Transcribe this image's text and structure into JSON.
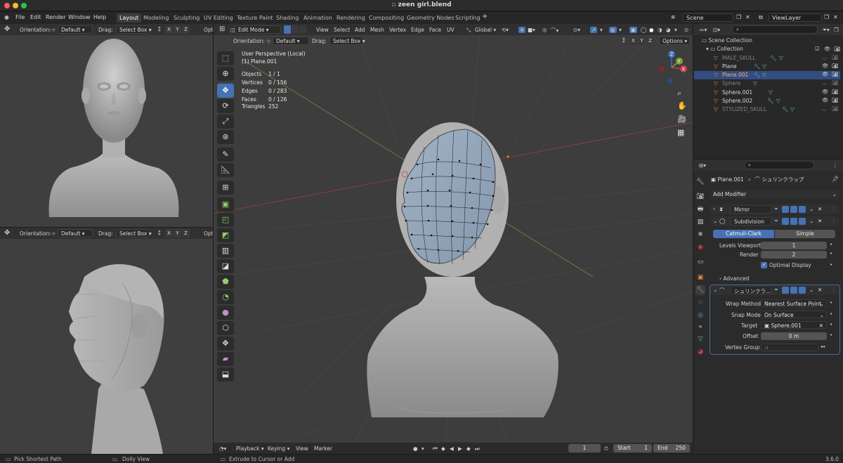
{
  "window": {
    "title": "zeen girl.blend"
  },
  "menu": {
    "items": [
      "File",
      "Edit",
      "Render",
      "Window",
      "Help"
    ]
  },
  "workspaces": [
    "Layout",
    "Modeling",
    "Sculpting",
    "UV Editing",
    "Texture Paint",
    "Shading",
    "Animation",
    "Rendering",
    "Compositing",
    "Geometry Nodes",
    "Scripting"
  ],
  "workspace_add": "+",
  "scene": {
    "name": "Scene",
    "view_layer": "ViewLayer"
  },
  "left_top": {
    "orientation_label": "Orientation:",
    "orientation_value": "Default",
    "drag_label": "Drag:",
    "drag_value": "Select Box",
    "axes": [
      "X",
      "Y",
      "Z"
    ],
    "options_short": "Opt"
  },
  "left_bottom": {
    "orientation_label": "Orientation:",
    "orientation_value": "Default",
    "drag_label": "Drag:",
    "drag_value": "Select Box",
    "axes": [
      "X",
      "Y",
      "Z"
    ],
    "options_short": "Opt"
  },
  "viewport": {
    "mode": "Edit Mode",
    "menus": [
      "View",
      "Select",
      "Add",
      "Mesh",
      "Vertex",
      "Edge",
      "Face",
      "UV"
    ],
    "transform": "Global",
    "orientation_label": "Orientation:",
    "orientation_value": "Default",
    "drag_label": "Drag:",
    "drag_value": "Select Box",
    "axes": [
      "X",
      "Y",
      "Z"
    ],
    "options": "Options",
    "perspective": "User Perspective (Local)",
    "object": "(1) Plane.001",
    "stats": [
      {
        "label": "Objects",
        "value": "1 / 1"
      },
      {
        "label": "Vertices",
        "value": "0 / 156"
      },
      {
        "label": "Edges",
        "value": "0 / 283"
      },
      {
        "label": "Faces",
        "value": "0 / 126"
      },
      {
        "label": "Triangles",
        "value": "252"
      }
    ],
    "gizmo": {
      "z": "Z",
      "y": "Y",
      "x": "X"
    }
  },
  "outliner": {
    "root": "Scene Collection",
    "collection": "Collection",
    "items": [
      {
        "name": "MALE_SKULL",
        "dim": true,
        "selected": false
      },
      {
        "name": "Plane",
        "dim": false,
        "selected": false
      },
      {
        "name": "Plane.001",
        "dim": false,
        "selected": true
      },
      {
        "name": "Sphere",
        "dim": true,
        "selected": false
      },
      {
        "name": "Sphere.001",
        "dim": false,
        "selected": false
      },
      {
        "name": "Sphere.002",
        "dim": false,
        "selected": false
      },
      {
        "name": "STYLIZED_SKULL",
        "dim": true,
        "selected": false
      }
    ]
  },
  "properties": {
    "object": "Plane.001",
    "modifier_path": "シュリンクラップ",
    "add_modifier": "Add Modifier",
    "mirror": {
      "name": "Mirror"
    },
    "subdivision": {
      "name": "Subdivision",
      "tab_a": "Catmull-Clark",
      "tab_b": "Simple",
      "levels_viewport_label": "Levels Viewport",
      "levels_viewport": "1",
      "render_label": "Render",
      "render": "2",
      "optimal_display": "Optimal Display",
      "advanced": "Advanced"
    },
    "shrinkwrap": {
      "name": "シュリンクラ...",
      "wrap_method_label": "Wrap Method",
      "wrap_method": "Nearest Surface Point",
      "snap_mode_label": "Snap Mode",
      "snap_mode": "On Surface",
      "target_label": "Target",
      "target": "Sphere.001",
      "offset_label": "Offset",
      "offset": "0 m",
      "vertex_group_label": "Vertex Group"
    }
  },
  "timeline": {
    "menus": [
      "Playback",
      "Keying",
      "View",
      "Marker"
    ],
    "current_frame": "1",
    "start_label": "Start",
    "start": "1",
    "end_label": "End",
    "end": "250"
  },
  "status": {
    "left": "Pick Shortest Path",
    "mid": "Dolly View",
    "right": "Extrude to Cursor or Add",
    "version": "3.6.0"
  },
  "colors": {
    "accent": "#4772b3",
    "selected_row": "#334d80",
    "mesh_wire": "#1a1a1a"
  }
}
